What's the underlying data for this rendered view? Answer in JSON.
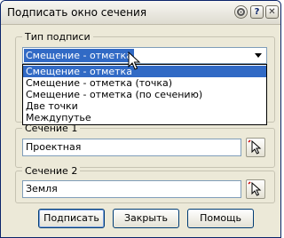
{
  "window": {
    "title": "Подписать окно сечения",
    "help_glyph": "?",
    "close_glyph": "✕"
  },
  "label_type": {
    "legend": "Тип подписи",
    "selected": "Смещение - отметка",
    "options": [
      "Смещение - отметка",
      "Смещение - отметка (точка)",
      "Смещение - отметка (по сечению)",
      "Две точки",
      "Междупутье"
    ]
  },
  "section1": {
    "legend": "Сечение 1",
    "value": "Проектная"
  },
  "section2": {
    "legend": "Сечение 2",
    "value": "Земля"
  },
  "buttons": {
    "sign": "Подписать",
    "close": "Закрыть",
    "help": "Помощь"
  },
  "colors": {
    "selection": "#316ac5",
    "window_border": "#0a246a",
    "dialog_bg": "#ece9d8"
  }
}
